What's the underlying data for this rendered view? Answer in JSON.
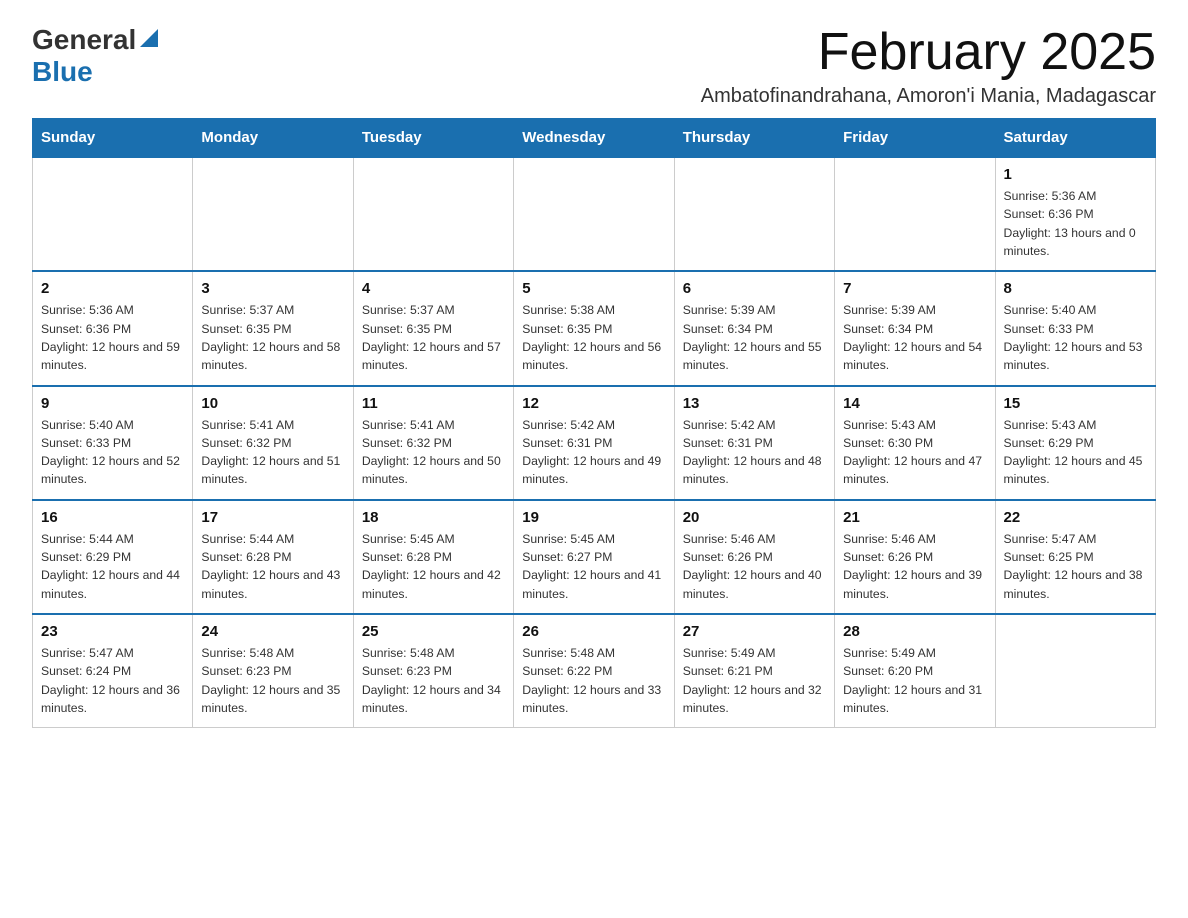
{
  "logo": {
    "general": "General",
    "blue": "Blue"
  },
  "title": "February 2025",
  "location": "Ambatofinandrahana, Amoron'i Mania, Madagascar",
  "days_of_week": [
    "Sunday",
    "Monday",
    "Tuesday",
    "Wednesday",
    "Thursday",
    "Friday",
    "Saturday"
  ],
  "weeks": [
    [
      {
        "day": "",
        "empty": true
      },
      {
        "day": "",
        "empty": true
      },
      {
        "day": "",
        "empty": true
      },
      {
        "day": "",
        "empty": true
      },
      {
        "day": "",
        "empty": true
      },
      {
        "day": "",
        "empty": true
      },
      {
        "day": "1",
        "sunrise": "5:36 AM",
        "sunset": "6:36 PM",
        "daylight": "13 hours and 0 minutes."
      }
    ],
    [
      {
        "day": "2",
        "sunrise": "5:36 AM",
        "sunset": "6:36 PM",
        "daylight": "12 hours and 59 minutes."
      },
      {
        "day": "3",
        "sunrise": "5:37 AM",
        "sunset": "6:35 PM",
        "daylight": "12 hours and 58 minutes."
      },
      {
        "day": "4",
        "sunrise": "5:37 AM",
        "sunset": "6:35 PM",
        "daylight": "12 hours and 57 minutes."
      },
      {
        "day": "5",
        "sunrise": "5:38 AM",
        "sunset": "6:35 PM",
        "daylight": "12 hours and 56 minutes."
      },
      {
        "day": "6",
        "sunrise": "5:39 AM",
        "sunset": "6:34 PM",
        "daylight": "12 hours and 55 minutes."
      },
      {
        "day": "7",
        "sunrise": "5:39 AM",
        "sunset": "6:34 PM",
        "daylight": "12 hours and 54 minutes."
      },
      {
        "day": "8",
        "sunrise": "5:40 AM",
        "sunset": "6:33 PM",
        "daylight": "12 hours and 53 minutes."
      }
    ],
    [
      {
        "day": "9",
        "sunrise": "5:40 AM",
        "sunset": "6:33 PM",
        "daylight": "12 hours and 52 minutes."
      },
      {
        "day": "10",
        "sunrise": "5:41 AM",
        "sunset": "6:32 PM",
        "daylight": "12 hours and 51 minutes."
      },
      {
        "day": "11",
        "sunrise": "5:41 AM",
        "sunset": "6:32 PM",
        "daylight": "12 hours and 50 minutes."
      },
      {
        "day": "12",
        "sunrise": "5:42 AM",
        "sunset": "6:31 PM",
        "daylight": "12 hours and 49 minutes."
      },
      {
        "day": "13",
        "sunrise": "5:42 AM",
        "sunset": "6:31 PM",
        "daylight": "12 hours and 48 minutes."
      },
      {
        "day": "14",
        "sunrise": "5:43 AM",
        "sunset": "6:30 PM",
        "daylight": "12 hours and 47 minutes."
      },
      {
        "day": "15",
        "sunrise": "5:43 AM",
        "sunset": "6:29 PM",
        "daylight": "12 hours and 45 minutes."
      }
    ],
    [
      {
        "day": "16",
        "sunrise": "5:44 AM",
        "sunset": "6:29 PM",
        "daylight": "12 hours and 44 minutes."
      },
      {
        "day": "17",
        "sunrise": "5:44 AM",
        "sunset": "6:28 PM",
        "daylight": "12 hours and 43 minutes."
      },
      {
        "day": "18",
        "sunrise": "5:45 AM",
        "sunset": "6:28 PM",
        "daylight": "12 hours and 42 minutes."
      },
      {
        "day": "19",
        "sunrise": "5:45 AM",
        "sunset": "6:27 PM",
        "daylight": "12 hours and 41 minutes."
      },
      {
        "day": "20",
        "sunrise": "5:46 AM",
        "sunset": "6:26 PM",
        "daylight": "12 hours and 40 minutes."
      },
      {
        "day": "21",
        "sunrise": "5:46 AM",
        "sunset": "6:26 PM",
        "daylight": "12 hours and 39 minutes."
      },
      {
        "day": "22",
        "sunrise": "5:47 AM",
        "sunset": "6:25 PM",
        "daylight": "12 hours and 38 minutes."
      }
    ],
    [
      {
        "day": "23",
        "sunrise": "5:47 AM",
        "sunset": "6:24 PM",
        "daylight": "12 hours and 36 minutes."
      },
      {
        "day": "24",
        "sunrise": "5:48 AM",
        "sunset": "6:23 PM",
        "daylight": "12 hours and 35 minutes."
      },
      {
        "day": "25",
        "sunrise": "5:48 AM",
        "sunset": "6:23 PM",
        "daylight": "12 hours and 34 minutes."
      },
      {
        "day": "26",
        "sunrise": "5:48 AM",
        "sunset": "6:22 PM",
        "daylight": "12 hours and 33 minutes."
      },
      {
        "day": "27",
        "sunrise": "5:49 AM",
        "sunset": "6:21 PM",
        "daylight": "12 hours and 32 minutes."
      },
      {
        "day": "28",
        "sunrise": "5:49 AM",
        "sunset": "6:20 PM",
        "daylight": "12 hours and 31 minutes."
      },
      {
        "day": "",
        "empty": true
      }
    ]
  ]
}
